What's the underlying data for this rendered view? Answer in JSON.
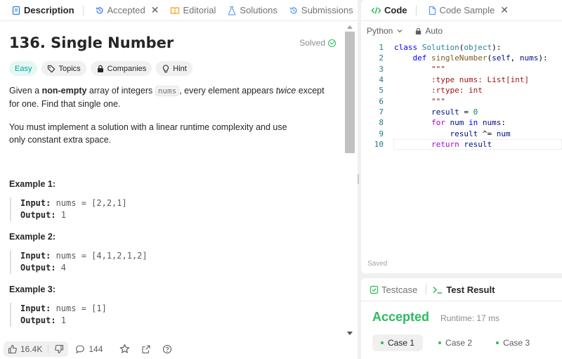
{
  "left_tabs": [
    {
      "label": "Description",
      "color": "#2b7de9"
    },
    {
      "label": "Accepted",
      "color": "#3b82f6"
    },
    {
      "label": "Editorial",
      "color": "#ffa116"
    },
    {
      "label": "Solutions",
      "color": "#5c9cf5"
    },
    {
      "label": "Submissions",
      "color": "#5c9cf5"
    }
  ],
  "problem": {
    "title": "136. Single Number",
    "solved": "Solved",
    "chips": {
      "easy": "Easy",
      "topics": "Topics",
      "companies": "Companies",
      "hint": "Hint"
    },
    "p1_pre": "Given a ",
    "p1_bold": "non-empty",
    "p1_mid": " array of integers ",
    "p1_code": "nums",
    "p1_mid2": ", every element appears ",
    "p1_em": "twice",
    "p1_post": " except for one. Find that single one.",
    "p2": "You must implement a solution with a linear runtime complexity and use only constant extra space.",
    "examples": [
      {
        "title": "Example 1:",
        "input_label": "Input:",
        "input": " nums = [2,2,1]",
        "output_label": "Output:",
        "output": " 1"
      },
      {
        "title": "Example 2:",
        "input_label": "Input:",
        "input": " nums = [4,1,2,1,2]",
        "output_label": "Output:",
        "output": " 4"
      },
      {
        "title": "Example 3:",
        "input_label": "Input:",
        "input": " nums = [1]",
        "output_label": "Output:",
        "output": " 1"
      }
    ]
  },
  "bottombar": {
    "likes": "16.4K",
    "comments": "144"
  },
  "right_tabs": {
    "code": "Code",
    "code_sample": "Code Sample"
  },
  "editor": {
    "language": "Python",
    "auto": "Auto",
    "saved": "Saved",
    "line_numbers": [
      "1",
      "2",
      "3",
      "4",
      "5",
      "6",
      "7",
      "8",
      "9",
      "10"
    ]
  },
  "result_tabs": {
    "testcase": "Testcase",
    "test_result": "Test Result"
  },
  "result": {
    "status": "Accepted",
    "runtime": "Runtime: 17 ms",
    "cases": [
      "Case 1",
      "Case 2",
      "Case 3"
    ]
  },
  "colors": {
    "accent_green": "#2cbb5d",
    "easy": "#00a79a",
    "link_blue": "#2b7de9"
  }
}
